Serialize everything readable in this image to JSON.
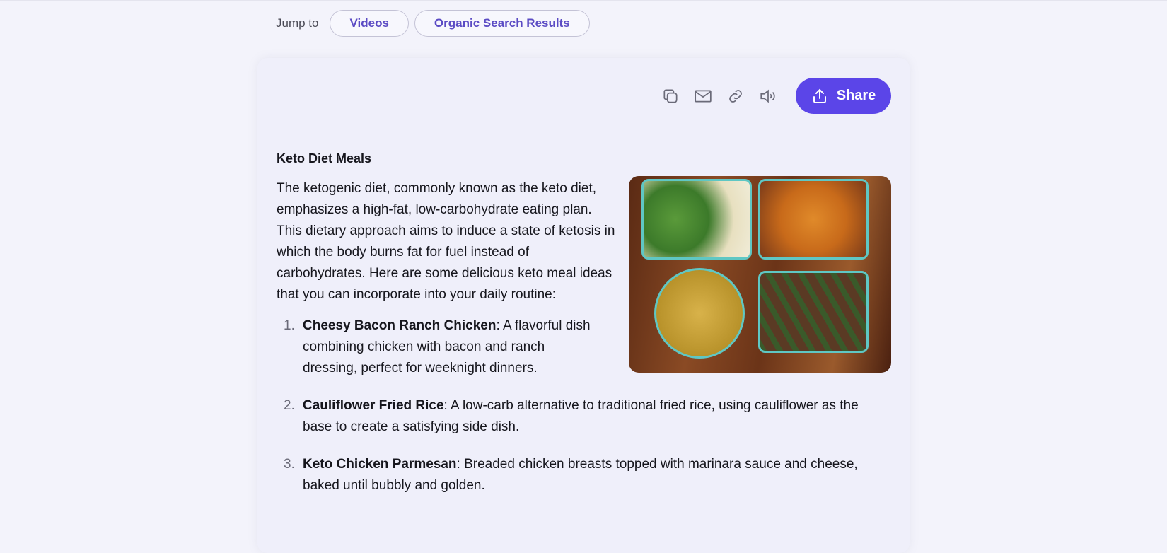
{
  "jump": {
    "label": "Jump to",
    "links": [
      "Videos",
      "Organic Search Results"
    ]
  },
  "toolbar": {
    "icons": [
      "copy-icon",
      "mail-icon",
      "link-icon",
      "speaker-icon"
    ],
    "share_label": "Share",
    "accent": "#5b45e8"
  },
  "article": {
    "title": "Keto Diet Meals",
    "intro": "The ketogenic diet, commonly known as the keto diet, emphasizes a high-fat, low-carbohydrate eating plan. This dietary approach aims to induce a state of ketosis in which the body burns fat for fuel instead of carbohydrates. Here are some delicious keto meal ideas that you can incorporate into your daily routine:",
    "items": [
      {
        "num": "1.",
        "name": "Cheesy Bacon Ranch Chicken",
        "desc": ": A flavorful dish combining chicken with bacon and ranch dressing, perfect for weeknight dinners."
      },
      {
        "num": "2.",
        "name": "Cauliflower Fried Rice",
        "desc": ": A low-carb alternative to traditional fried rice, using cauliflower as the base to create a satisfying side dish."
      },
      {
        "num": "3.",
        "name": "Keto Chicken Parmesan",
        "desc": ": Breaded chicken breasts topped with marinara sauce and cheese, baked until bubbly and golden."
      }
    ]
  }
}
